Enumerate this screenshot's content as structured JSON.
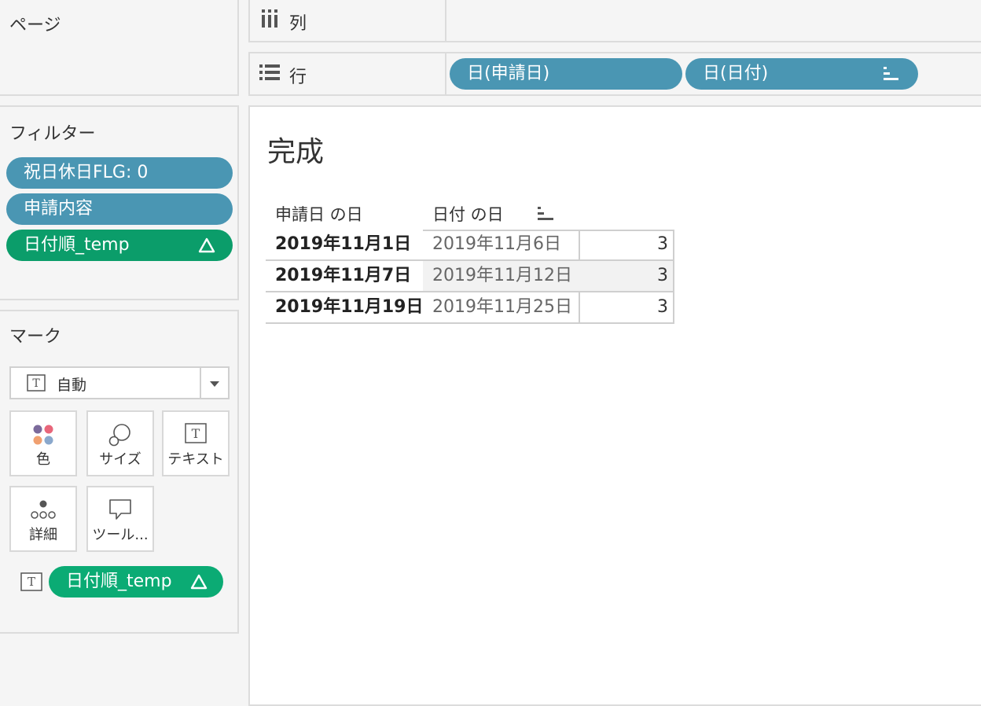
{
  "shelves": {
    "pages": {
      "label": "ページ"
    },
    "columns": {
      "label": "列"
    },
    "rows": {
      "label": "行",
      "pills": [
        "日(申請日)",
        "日(日付)"
      ]
    }
  },
  "filters": {
    "title": "フィルター",
    "items": [
      "祝日休日FLG: 0",
      "申請内容",
      "日付順_temp"
    ]
  },
  "marks": {
    "title": "マーク",
    "type_label": "自動",
    "cards": {
      "color": "色",
      "size": "サイズ",
      "text": "テキスト",
      "detail": "詳細",
      "tooltip": "ツール..."
    },
    "text_pill": "日付順_temp"
  },
  "view": {
    "title": "完成",
    "headers": [
      "申請日 の日",
      "日付 の日"
    ],
    "rows": [
      {
        "a": "2019年11月1日",
        "b": "2019年11月6日",
        "v": "3"
      },
      {
        "a": "2019年11月7日",
        "b": "2019年11月12日",
        "v": "3"
      },
      {
        "a": "2019年11月19日",
        "b": "2019年11月25日",
        "v": "3"
      }
    ]
  },
  "colors": {
    "dimension_pill": "#4a96b3",
    "measure_pill": "#0b9d6a"
  }
}
